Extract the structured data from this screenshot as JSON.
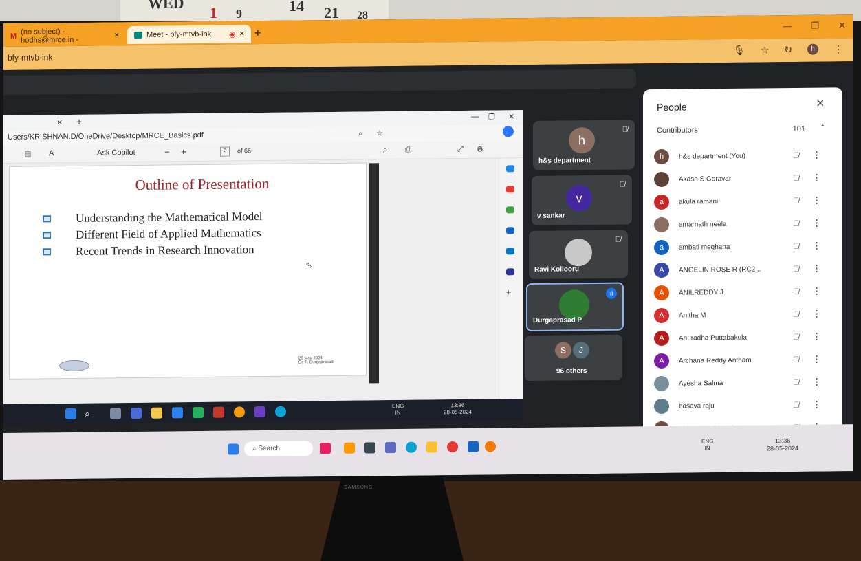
{
  "calendar": {
    "day": "WED",
    "dates": [
      "1",
      "9",
      "14",
      "21",
      "28"
    ]
  },
  "browser": {
    "tabs": [
      {
        "label": "(no subject) - hodhs@mrce.in -",
        "icon": "gmail-icon"
      },
      {
        "label": "Meet - bfy-mtvb-ink",
        "icon": "meet-icon"
      }
    ],
    "url": "bfy-mtvb-ink",
    "profile_initial": "h"
  },
  "presentation": {
    "tab_close": "×",
    "tab_new": "+",
    "file_path": "Users/KRISHNAN.D/OneDrive/Desktop/MRCE_Basics.pdf",
    "toolbar": {
      "ask_copilot": "Ask Copilot",
      "page_current": "2",
      "page_total": "of 66",
      "minus": "−",
      "plus": "+"
    },
    "slide": {
      "title": "Outline of Presentation",
      "bullets": [
        "Understanding the Mathematical Model",
        "Different Field of Applied Mathematics",
        "Recent Trends in Research Innovation"
      ],
      "date": "28 May 2024",
      "author": "Dr. P. Durgaprasad"
    },
    "inner_taskbar": {
      "lang": "ENG",
      "lang_sub": "IN",
      "time": "13:36",
      "date": "28-05-2024"
    }
  },
  "tiles": [
    {
      "name": "h&s department",
      "initial": "h",
      "color": "#8d6e63"
    },
    {
      "name": "v sankar",
      "initial": "v",
      "color": "#4527a0"
    },
    {
      "name": "Ravi Kollooru",
      "initial": "",
      "color": "#c8c8c8"
    },
    {
      "name": "Durgaprasad P",
      "initial": "",
      "color": "#2e7d32"
    },
    {
      "name": "96 others",
      "initials": [
        "S",
        "J"
      ],
      "colors": [
        "#8d6e63",
        "#546e7a"
      ]
    }
  ],
  "people": {
    "title": "People",
    "section": "Contributors",
    "count": "101",
    "list": [
      {
        "name": "h&s department (You)",
        "initial": "h",
        "color": "#6d4c41"
      },
      {
        "name": "Akash S Goravar",
        "initial": "",
        "color": "#5d4037"
      },
      {
        "name": "akula ramani",
        "initial": "a",
        "color": "#c62828"
      },
      {
        "name": "amarnath neela",
        "initial": "",
        "color": "#8d6e63"
      },
      {
        "name": "ambati meghana",
        "initial": "a",
        "color": "#1565c0"
      },
      {
        "name": "ANGELIN ROSE R (RC2...",
        "initial": "A",
        "color": "#3949ab"
      },
      {
        "name": "ANILREDDY J",
        "initial": "A",
        "color": "#e65100"
      },
      {
        "name": "Anitha M",
        "initial": "A",
        "color": "#d32f2f"
      },
      {
        "name": "Anuradha Puttabakula",
        "initial": "A",
        "color": "#b71c1c"
      },
      {
        "name": "Archana Reddy Antham",
        "initial": "A",
        "color": "#7b1fa2"
      },
      {
        "name": "Ayesha Salma",
        "initial": "",
        "color": "#78909c"
      },
      {
        "name": "basava raju",
        "initial": "",
        "color": "#607d8b"
      },
      {
        "name": "Bhuven Pothineni",
        "initial": "",
        "color": "#6d4c41"
      }
    ]
  },
  "controls": {
    "raise_badge": "1",
    "people_badge": "101"
  },
  "outer_taskbar": {
    "search": "Search",
    "lang": "ENG",
    "lang_sub": "IN",
    "time": "13:36",
    "date": "28-05-2024"
  },
  "monitor_brand": "SAMSUNG"
}
